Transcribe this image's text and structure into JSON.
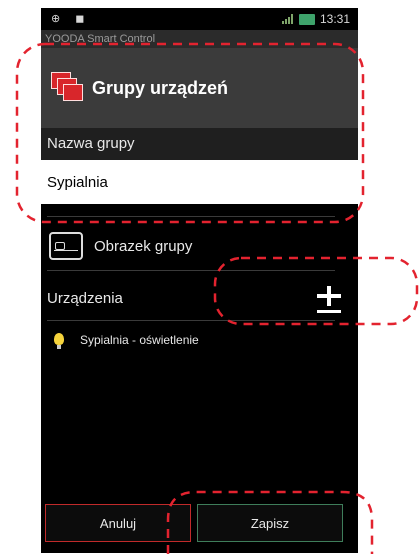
{
  "statusbar": {
    "left_icons": "⊕ ◼",
    "time": "13:31"
  },
  "app": {
    "name": "YOODA Smart Control"
  },
  "header": {
    "title": "Grupy urządzeń"
  },
  "form": {
    "group_name_label": "Nazwa grupy",
    "group_name_value": "Sypialnia",
    "group_image_label": "Obrazek grupy",
    "devices_label": "Urządzenia",
    "devices": [
      {
        "name": "Sypialnia - oświetlenie",
        "icon": "bulb-icon"
      }
    ]
  },
  "buttons": {
    "cancel": "Anuluj",
    "save": "Zapisz"
  },
  "colors": {
    "annotation": "#e3232f",
    "cancel_border": "#c02a2a",
    "save_border": "#3e7d5a",
    "battery": "#3ea36b",
    "bulb": "#f5d33c"
  }
}
